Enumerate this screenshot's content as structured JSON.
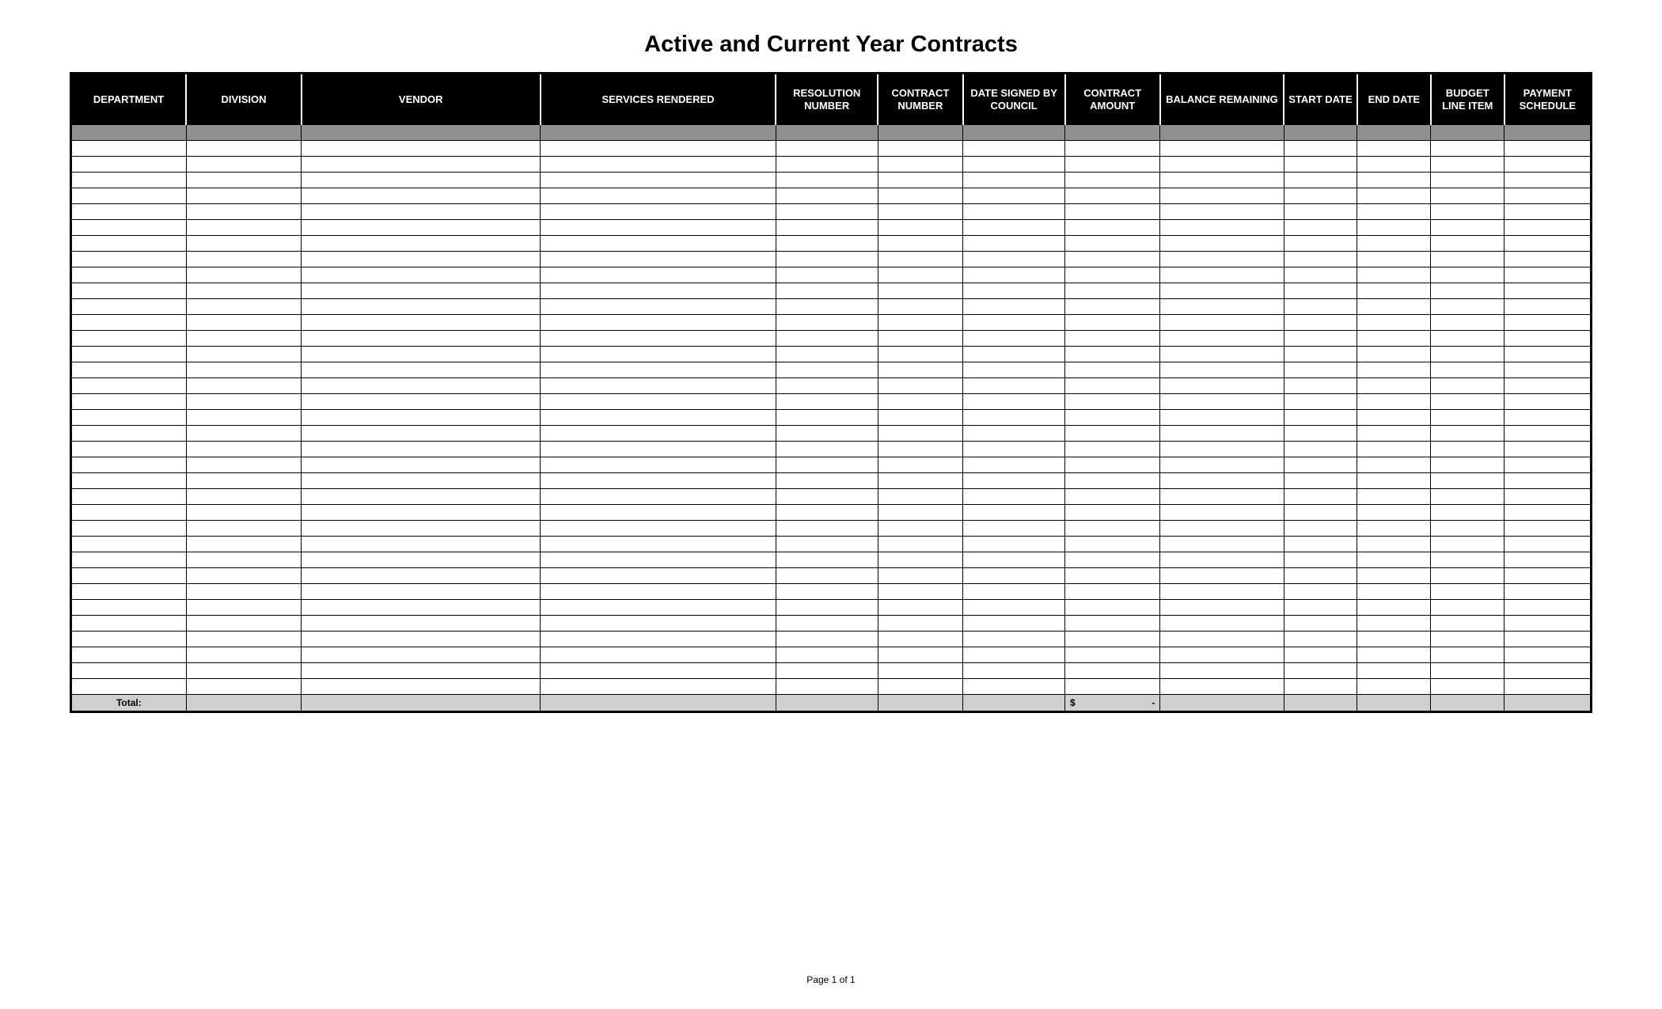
{
  "title": "Active and Current Year Contracts",
  "columns": [
    {
      "key": "department",
      "label": "DEPARTMENT"
    },
    {
      "key": "division",
      "label": "DIVISION"
    },
    {
      "key": "vendor",
      "label": "VENDOR"
    },
    {
      "key": "services-rendered",
      "label": "SERVICES RENDERED"
    },
    {
      "key": "resolution-number",
      "label": "RESOLUTION NUMBER"
    },
    {
      "key": "contract-number",
      "label": "CONTRACT NUMBER"
    },
    {
      "key": "date-signed",
      "label": "DATE SIGNED BY COUNCIL"
    },
    {
      "key": "contract-amount",
      "label": "CONTRACT AMOUNT"
    },
    {
      "key": "balance-remaining",
      "label": "BALANCE REMAINING"
    },
    {
      "key": "start-date",
      "label": "START DATE"
    },
    {
      "key": "end-date",
      "label": "END DATE"
    },
    {
      "key": "budget-line-item",
      "label": "BUDGET LINE ITEM"
    },
    {
      "key": "payment-schedule",
      "label": "PAYMENT SCHEDULE"
    }
  ],
  "blank_row_count": 35,
  "total_row": {
    "label": "Total:",
    "contract_amount_currency": "$",
    "contract_amount_value": "-"
  },
  "footer": "Page 1 of 1"
}
